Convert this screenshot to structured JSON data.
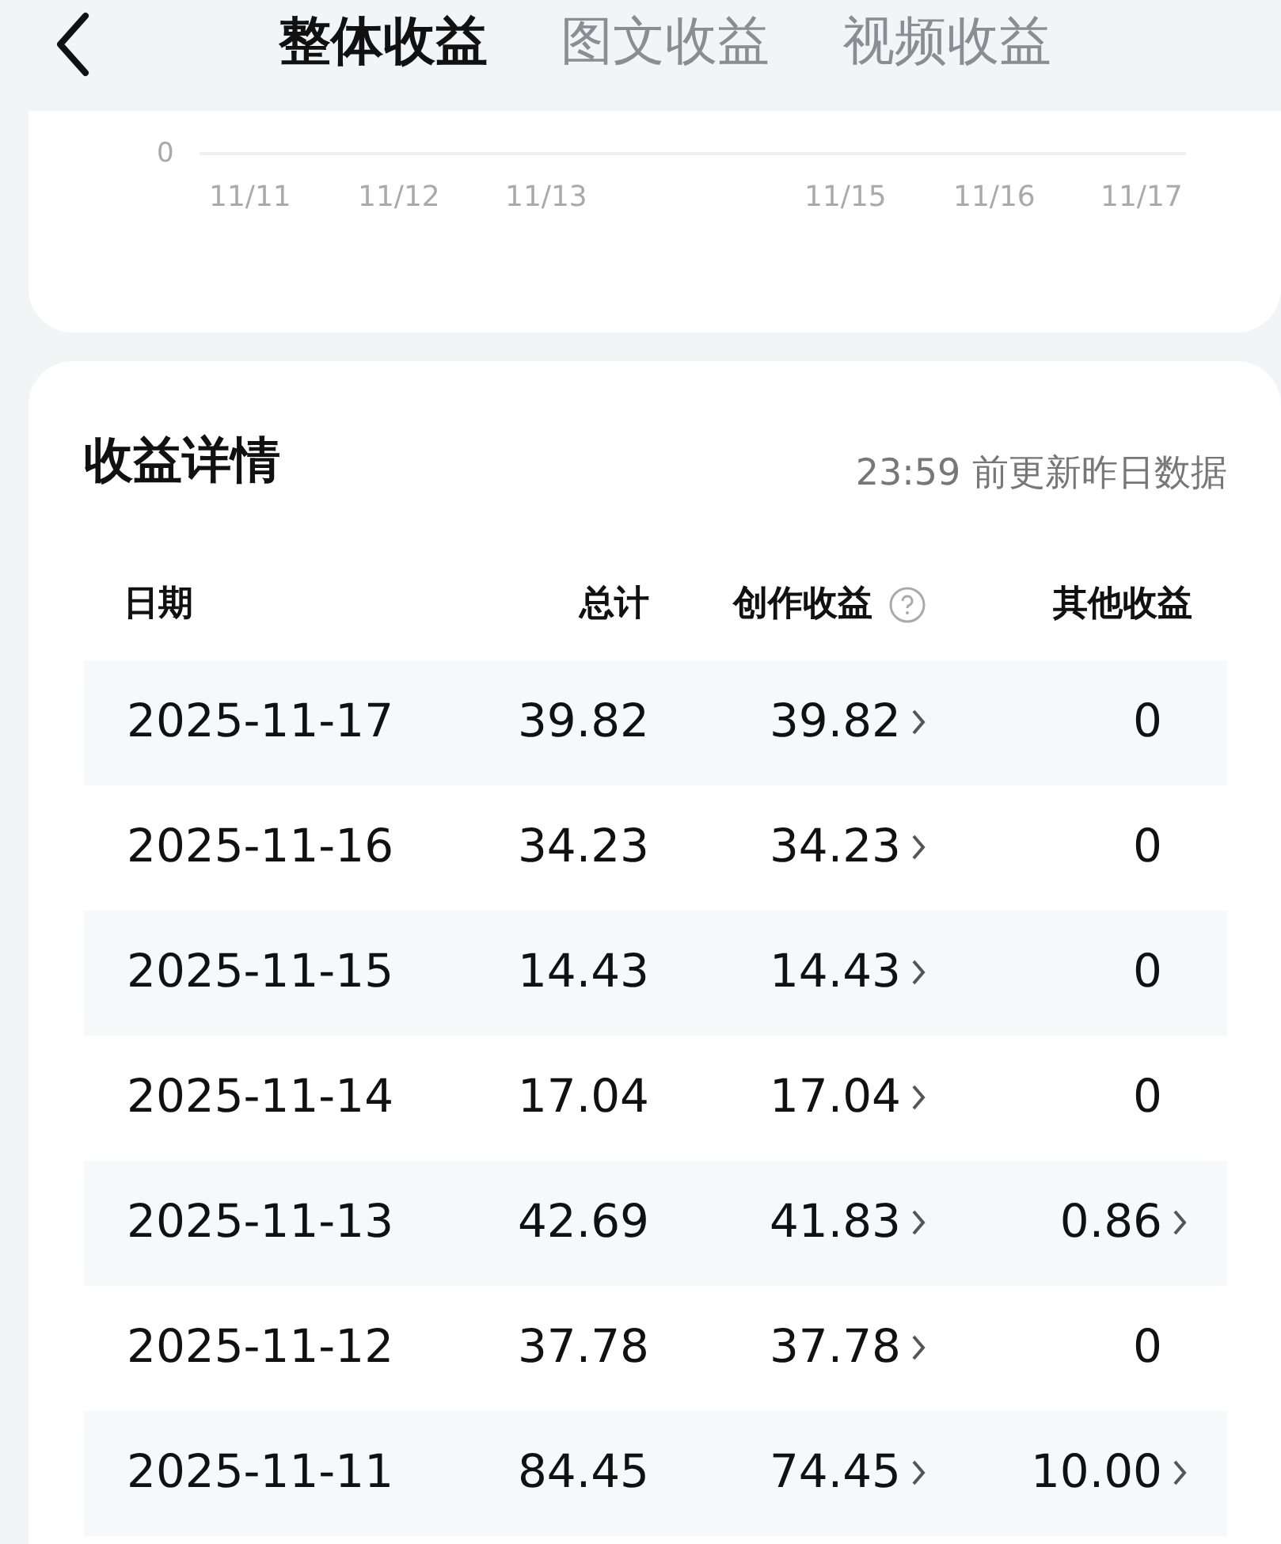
{
  "header": {
    "tabs": [
      {
        "label": "整体收益",
        "selected": true
      },
      {
        "label": "图文收益",
        "selected": false
      },
      {
        "label": "视频收益",
        "selected": false
      }
    ]
  },
  "chart": {
    "y_tick": "0",
    "x_labels": [
      "11/11",
      "11/12",
      "11/13",
      "11/15",
      "11/16",
      "11/17"
    ]
  },
  "details": {
    "title": "收益详情",
    "note": "23:59 前更新昨日数据",
    "columns": [
      "日期",
      "总计",
      "创作收益",
      "其他收益"
    ],
    "rows": [
      {
        "date": "2025-11-17",
        "total": "39.82",
        "creation": "39.82",
        "creation_link": true,
        "other": "0",
        "other_link": false
      },
      {
        "date": "2025-11-16",
        "total": "34.23",
        "creation": "34.23",
        "creation_link": true,
        "other": "0",
        "other_link": false
      },
      {
        "date": "2025-11-15",
        "total": "14.43",
        "creation": "14.43",
        "creation_link": true,
        "other": "0",
        "other_link": false
      },
      {
        "date": "2025-11-14",
        "total": "17.04",
        "creation": "17.04",
        "creation_link": true,
        "other": "0",
        "other_link": false
      },
      {
        "date": "2025-11-13",
        "total": "42.69",
        "creation": "41.83",
        "creation_link": true,
        "other": "0.86",
        "other_link": true
      },
      {
        "date": "2025-11-12",
        "total": "37.78",
        "creation": "37.78",
        "creation_link": true,
        "other": "0",
        "other_link": false
      },
      {
        "date": "2025-11-11",
        "total": "84.45",
        "creation": "74.45",
        "creation_link": true,
        "other": "10.00",
        "other_link": true
      }
    ]
  }
}
